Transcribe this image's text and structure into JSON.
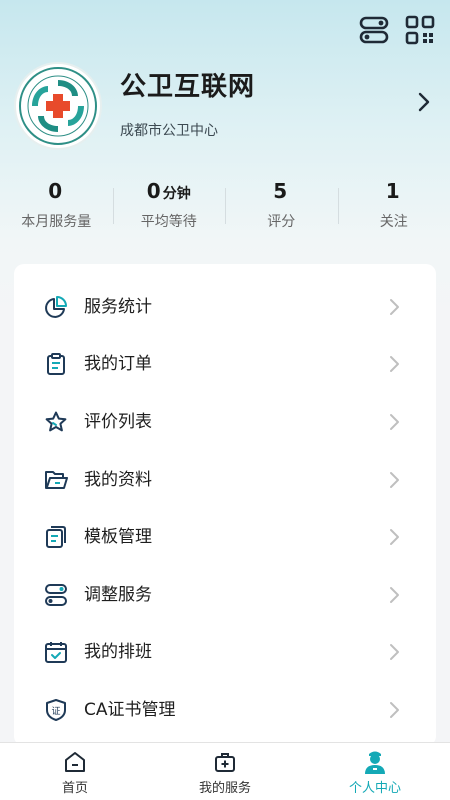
{
  "profile": {
    "name": "公卫互联网",
    "subtitle": "成都市公卫中心"
  },
  "stats": [
    {
      "value": "0",
      "unit": "",
      "label": "本月服务量"
    },
    {
      "value": "0",
      "unit": "分钟",
      "label": "平均等待"
    },
    {
      "value": "5",
      "unit": "",
      "label": "评分"
    },
    {
      "value": "1",
      "unit": "",
      "label": "关注"
    }
  ],
  "menu": [
    {
      "label": "服务统计",
      "icon": "pie-chart-icon"
    },
    {
      "label": "我的订单",
      "icon": "clipboard-icon"
    },
    {
      "label": "评价列表",
      "icon": "star-icon"
    },
    {
      "label": "我的资料",
      "icon": "folder-icon"
    },
    {
      "label": "模板管理",
      "icon": "template-icon"
    },
    {
      "label": "调整服务",
      "icon": "toggle-icon"
    },
    {
      "label": "我的排班",
      "icon": "calendar-icon"
    },
    {
      "label": "CA证书管理",
      "icon": "certificate-shield-icon"
    }
  ],
  "tabs": [
    {
      "label": "首页",
      "icon": "home-icon",
      "active": false
    },
    {
      "label": "我的服务",
      "icon": "medical-bag-icon",
      "active": false
    },
    {
      "label": "个人中心",
      "icon": "doctor-icon",
      "active": true
    }
  ],
  "colors": {
    "accent": "#14a9b6",
    "icon": "#1f3a57",
    "logo_red": "#e84a2b",
    "logo_teal": "#1f8e84"
  }
}
